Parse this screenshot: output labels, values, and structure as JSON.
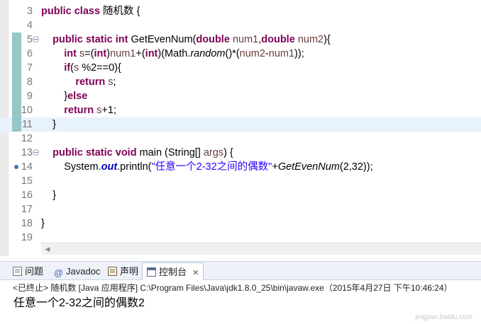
{
  "editor": {
    "lines": [
      {
        "num": "3",
        "parts": [
          [
            "kw",
            "public class "
          ],
          [
            "",
            "随机数 {"
          ]
        ]
      },
      {
        "num": "4",
        "parts": []
      },
      {
        "num": "5",
        "fold": true,
        "changed": true,
        "parts": [
          [
            "",
            "    "
          ],
          [
            "kw",
            "public static int "
          ],
          [
            "",
            "GetEvenNum("
          ],
          [
            "kw",
            "double "
          ],
          [
            "var",
            "num1"
          ],
          [
            "",
            ","
          ],
          [
            "kw",
            "double "
          ],
          [
            "var",
            "num2"
          ],
          [
            "",
            "){"
          ]
        ]
      },
      {
        "num": "6",
        "changed": true,
        "parts": [
          [
            "",
            "        "
          ],
          [
            "kw",
            "int "
          ],
          [
            "var",
            "s"
          ],
          [
            "",
            "=("
          ],
          [
            "kw",
            "int"
          ],
          [
            "",
            ")"
          ],
          [
            "var",
            "num1"
          ],
          [
            "",
            "+("
          ],
          [
            "kw",
            "int"
          ],
          [
            "",
            ")(Math."
          ],
          [
            "it",
            "random"
          ],
          [
            "",
            "()*("
          ],
          [
            "var",
            "num2"
          ],
          [
            "",
            "-"
          ],
          [
            "var",
            "num1"
          ],
          [
            "",
            "));"
          ]
        ]
      },
      {
        "num": "7",
        "changed": true,
        "parts": [
          [
            "",
            "        "
          ],
          [
            "kw",
            "if"
          ],
          [
            "",
            "("
          ],
          [
            "var",
            "s"
          ],
          [
            "",
            " %2==0){"
          ]
        ]
      },
      {
        "num": "8",
        "changed": true,
        "parts": [
          [
            "",
            "            "
          ],
          [
            "kw",
            "return "
          ],
          [
            "var",
            "s"
          ],
          [
            "",
            ";"
          ]
        ]
      },
      {
        "num": "9",
        "changed": true,
        "parts": [
          [
            "",
            "        }"
          ],
          [
            "kw",
            "else"
          ]
        ]
      },
      {
        "num": "10",
        "changed": true,
        "parts": [
          [
            "",
            "        "
          ],
          [
            "kw",
            "return "
          ],
          [
            "var",
            "s"
          ],
          [
            "",
            "+1;"
          ]
        ]
      },
      {
        "num": "11",
        "changed": true,
        "current": true,
        "parts": [
          [
            "",
            "    }"
          ]
        ]
      },
      {
        "num": "12",
        "parts": []
      },
      {
        "num": "13",
        "fold": true,
        "parts": [
          [
            "",
            "    "
          ],
          [
            "kw",
            "public static void "
          ],
          [
            "",
            "main (String[] "
          ],
          [
            "var",
            "args"
          ],
          [
            "",
            ") {"
          ]
        ]
      },
      {
        "num": "14",
        "breakpoint": true,
        "parts": [
          [
            "",
            "        System."
          ],
          [
            "fld",
            "out"
          ],
          [
            "",
            ".println("
          ],
          [
            "str",
            "\"任意一个2-32之间的偶数\""
          ],
          [
            "",
            "+"
          ],
          [
            "it",
            "GetEvenNum"
          ],
          [
            "",
            "(2,32));"
          ]
        ]
      },
      {
        "num": "15",
        "parts": []
      },
      {
        "num": "16",
        "parts": [
          [
            "",
            "    }"
          ]
        ]
      },
      {
        "num": "17",
        "parts": []
      },
      {
        "num": "18",
        "parts": [
          [
            "",
            "}"
          ]
        ]
      },
      {
        "num": "19",
        "parts": []
      }
    ]
  },
  "tabs": {
    "problems": "问题",
    "javadoc": "Javadoc",
    "declaration": "声明",
    "console": "控制台",
    "close_glyph": "✕"
  },
  "console": {
    "header": "<已终止> 随机数 [Java 应用程序] C:\\Program Files\\Java\\jdk1.8.0_25\\bin\\javaw.exe（2015年4月27日 下午10:46:24）",
    "output": "任意一个2-32之间的偶数2"
  },
  "watermark": "jingyan.baidu.com",
  "colors": {
    "keyword": "#7f0055",
    "variable": "#6a3e3e",
    "string": "#2a00ff",
    "static_field": "#0000c0",
    "current_line": "#e8f2fe",
    "change_bar": "#95c7c7"
  }
}
